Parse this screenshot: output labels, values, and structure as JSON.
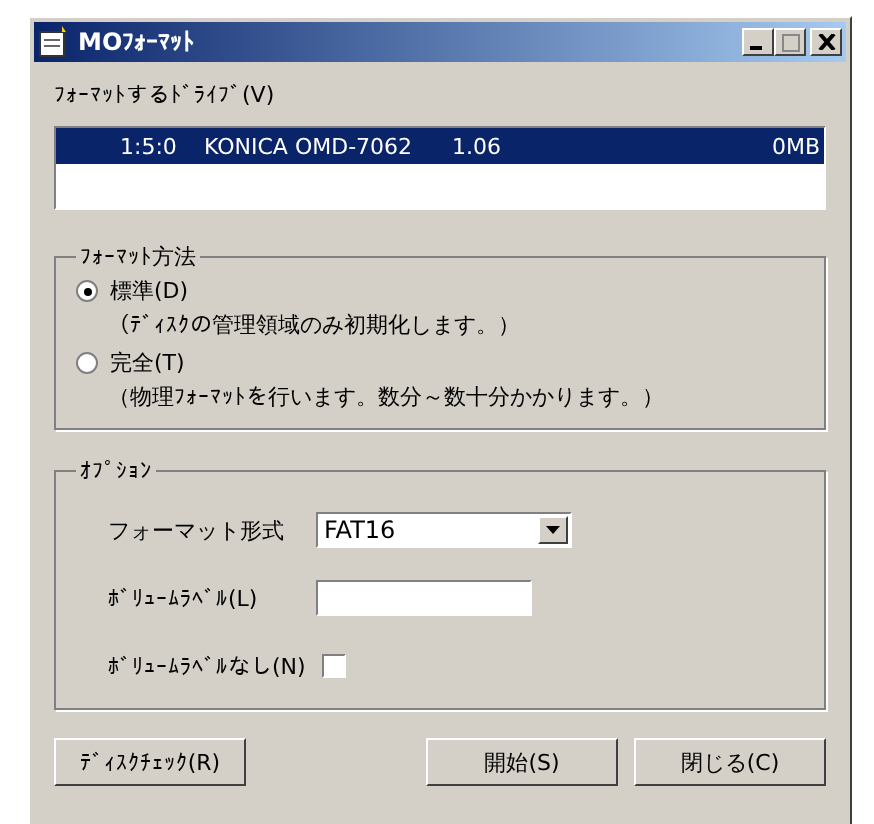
{
  "window": {
    "title": "MOﾌｫｰﾏｯﾄ"
  },
  "drive": {
    "label": "ﾌｫｰﾏｯﾄするﾄﾞﾗｲﾌﾞ(V)",
    "rows": [
      {
        "cells": [
          "1:5:0",
          "KONICA  OMD-7062",
          "1.06",
          "0MB"
        ],
        "selected": true
      }
    ]
  },
  "method": {
    "title": "ﾌｫｰﾏｯﾄ方法",
    "options": [
      {
        "label": "標準(D)",
        "description": "（ﾃﾞｨｽｸの管理領域のみ初期化します。）",
        "selected": true
      },
      {
        "label": "完全(T)",
        "description": "（物理ﾌｫｰﾏｯﾄを行います。数分～数十分かかります。）",
        "selected": false
      }
    ]
  },
  "options": {
    "title": "ｵﾌﾟｼｮﾝ",
    "format_label": "フォーマット形式",
    "format_value": "FAT16",
    "volume_label": "ﾎﾞﾘｭｰﾑﾗﾍﾞﾙ(L)",
    "no_label": "ﾎﾞﾘｭｰﾑﾗﾍﾞﾙなし(N)",
    "no_label_checked": false
  },
  "buttons": {
    "disk_check": "ﾃﾞｨｽｸﾁｪｯｸ(R)",
    "start": "開始(S)",
    "close": "閉じる(C)"
  }
}
